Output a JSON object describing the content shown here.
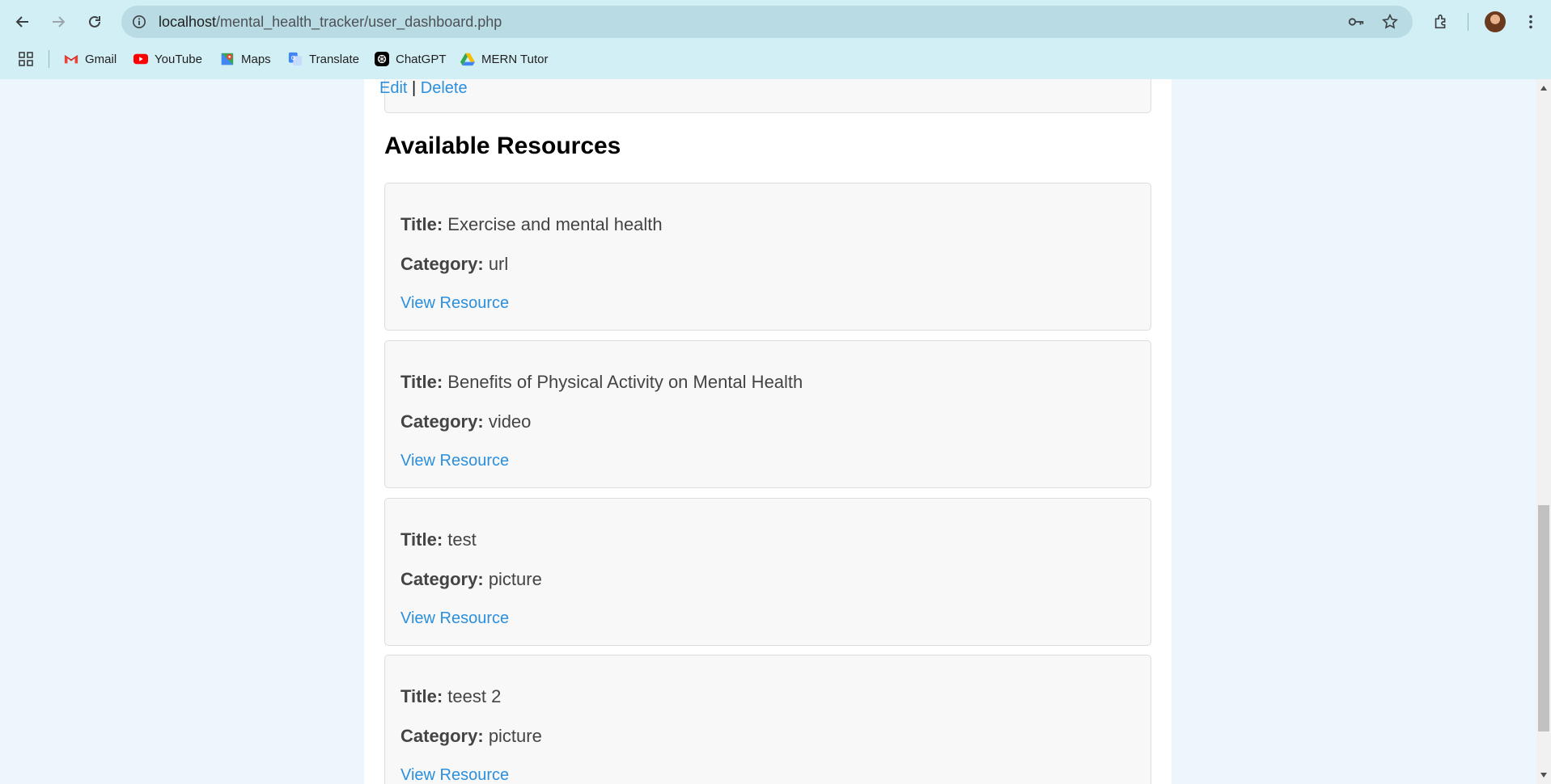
{
  "browser": {
    "url_host": "localhost",
    "url_path": "/mental_health_tracker/user_dashboard.php",
    "bookmarks": [
      {
        "label": "Gmail",
        "icon": "gmail-icon"
      },
      {
        "label": "YouTube",
        "icon": "youtube-icon"
      },
      {
        "label": "Maps",
        "icon": "maps-icon"
      },
      {
        "label": "Translate",
        "icon": "translate-icon"
      },
      {
        "label": "ChatGPT",
        "icon": "chatgpt-icon"
      },
      {
        "label": "MERN Tutor",
        "icon": "drive-icon"
      }
    ]
  },
  "page": {
    "top_card": {
      "edit_label": "Edit",
      "separator": "|",
      "delete_label": "Delete"
    },
    "resources_heading": "Available Resources",
    "title_label": "Title:",
    "category_label": "Category:",
    "resources": [
      {
        "title": "Exercise and mental health",
        "category": "url",
        "link_label": "View Resource"
      },
      {
        "title": "Benefits of Physical Activity on Mental Health",
        "category": "video",
        "link_label": "View Resource"
      },
      {
        "title": "test",
        "category": "picture",
        "link_label": "View Resource"
      },
      {
        "title": "teest 2",
        "category": "picture",
        "link_label": "View Resource"
      }
    ]
  },
  "colors": {
    "chrome": "#d3eff6",
    "page_background": "#eef6fd",
    "link": "#2b8fdc",
    "card_background": "#f8f8f8"
  }
}
